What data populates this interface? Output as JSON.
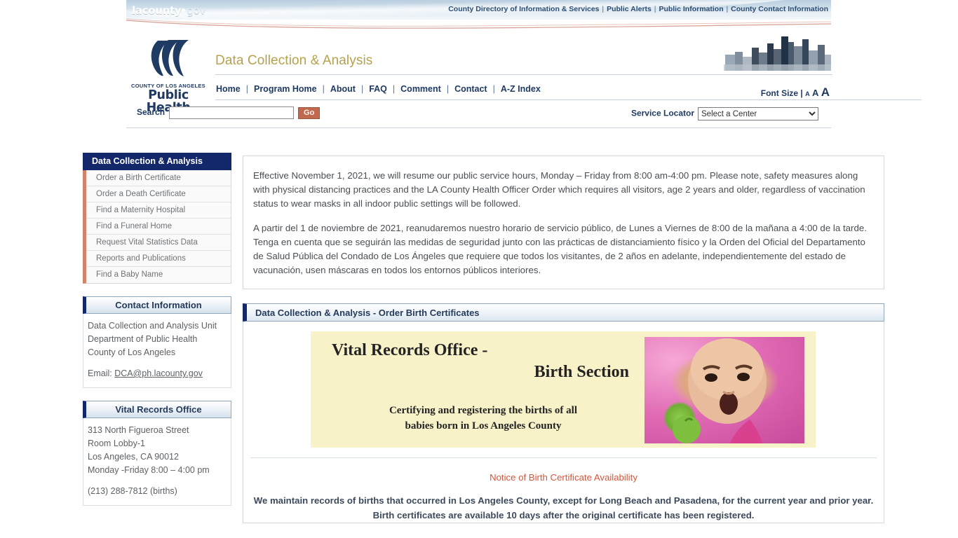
{
  "county_bar": {
    "logo_text": "lacounty",
    "logo_suffix": "gov",
    "links": [
      "County Directory of Information & Services",
      "Public Alerts",
      "Public Information",
      "County Contact Information"
    ]
  },
  "header": {
    "logo_county_line": "COUNTY OF LOS ANGELES",
    "logo_dept_line": "Public Health",
    "site_title": "Data Collection & Analysis",
    "nav": [
      "Home",
      "Program Home",
      "About",
      "FAQ",
      "Comment",
      "Contact",
      "A-Z Index"
    ],
    "font_size_label": "Font Size |",
    "font_size_options": [
      "A",
      "A",
      "A"
    ],
    "search_label": "Search",
    "search_value": "",
    "search_placeholder": "",
    "go_label": "Go",
    "service_locator_label": "Service Locator",
    "service_locator_selected": "Select a Center"
  },
  "sidebar": {
    "nav_title": "Data Collection & Analysis",
    "nav_items": [
      "Order a Birth Certificate",
      "Order a Death Certificate",
      "Find a Maternity Hospital",
      "Find a Funeral Home",
      "Request Vital Statistics Data",
      "Reports and Publications",
      "Find a Baby Name"
    ],
    "contact_panel": {
      "title": "Contact Information",
      "line1": "Data Collection and Analysis Unit",
      "line2": "Department of Public Health",
      "line3": "County of Los Angeles",
      "email_label": "Email:",
      "email": "DCA@ph.lacounty.gov"
    },
    "vital_panel": {
      "title": "Vital Records Office",
      "line1": "313 North Figueroa Street",
      "line2": "Room Lobby-1",
      "line3": "Los Angeles, CA 90012",
      "line4": "Monday -Friday 8:00 – 4:00 pm",
      "phone1": "(213) 288-7812 (births)"
    }
  },
  "main": {
    "notice_en": "Effective November 1, 2021, we will resume our public service hours, Monday – Friday from 8:00 am-4:00 pm. Please note, safety measures along with physical distancing practices and the LA County Health Officer Order which requires all visitors, age 2 years and older, regardless of vaccination status to wear masks in all indoor public settings will be followed.",
    "notice_es": "A partir del 1 de noviembre de 2021, reanudaremos nuestro horario de servicio público, de Lunes a Viernes de 8:00 de la mañana a 4:00 de la tarde. Tenga en cuenta que se seguirán las medidas de seguridad junto con las prácticas de distanciamiento físico y la Orden del Oficial del Departamento de Salud Pública del Condado de Los Ángeles que requiere que todos los visitantes, de 2 años en adelante, independientemente del estado de vacunación, usen máscaras en todos los entornos públicos interiores.",
    "section_title": "Data Collection & Analysis - Order Birth Certificates",
    "banner": {
      "title_line1": "Vital Records Office -",
      "title_line2": "Birth Section",
      "subtitle_line1": "Certifying and registering the births of all",
      "subtitle_line2": "babies born in Los Angeles County",
      "photo_alt": "baby-photo"
    },
    "availability_title": "Notice of Birth Certificate Availability",
    "availability_line1": "We maintain records of births that occurred in Los Angeles County, except for Long Beach and Pasadena, for the current year and prior year.",
    "availability_line2": "Birth certificates are available 10 days after the original certificate has been registered."
  },
  "colors": {
    "navy": "#13286b",
    "gold": "#b5a14e",
    "accent_orange": "#c0694f",
    "banner_bg": "#f8f2c9",
    "notice_red": "#d4573c"
  }
}
